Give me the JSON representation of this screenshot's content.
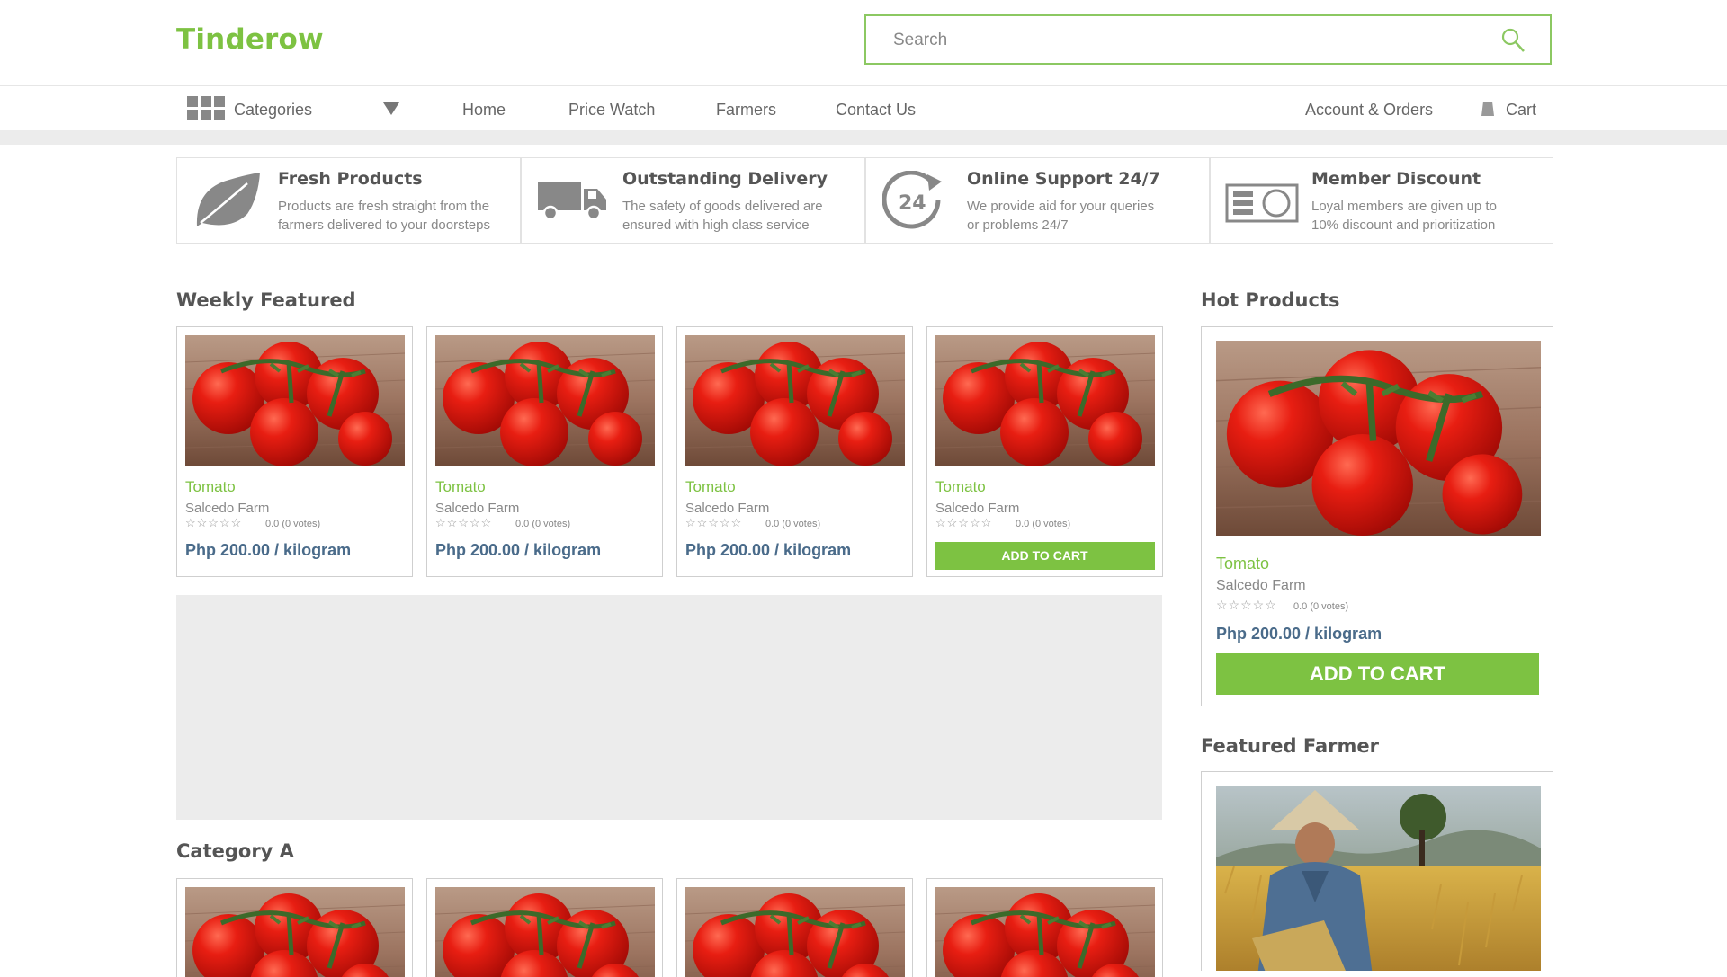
{
  "header": {
    "logo": "Tinderow",
    "search_placeholder": "Search"
  },
  "nav": {
    "categories_label": "Categories",
    "links": [
      "Home",
      "Price Watch",
      "Farmers",
      "Contact Us"
    ],
    "account_label": "Account & Orders",
    "cart_label": "Cart"
  },
  "features": [
    {
      "title": "Fresh Products",
      "line1": "Products are fresh straight from the",
      "line2": "farmers delivered to your doorsteps",
      "icon": "leaf-icon"
    },
    {
      "title": "Outstanding Delivery",
      "line1": "The safety of goods delivered are",
      "line2": "ensured with high class service",
      "icon": "truck-icon"
    },
    {
      "title": "Online Support 24/7",
      "line1": "We provide aid for your queries",
      "line2": "or problems 24/7",
      "icon": "support-24-icon"
    },
    {
      "title": "Member Discount",
      "line1": "Loyal members are given up to",
      "line2": "10% discount and prioritization",
      "icon": "member-card-icon"
    }
  ],
  "weekly_featured": {
    "title": "Weekly Featured",
    "products": [
      {
        "name": "Tomato",
        "farm": "Salcedo Farm",
        "stars": "☆☆☆☆☆",
        "votes": "0.0 (0 votes)",
        "price": "Php 200.00 / kilogram"
      },
      {
        "name": "Tomato",
        "farm": "Salcedo Farm",
        "stars": "☆☆☆☆☆",
        "votes": "0.0 (0 votes)",
        "price": "Php 200.00 / kilogram"
      },
      {
        "name": "Tomato",
        "farm": "Salcedo Farm",
        "stars": "☆☆☆☆☆",
        "votes": "0.0 (0 votes)",
        "price": "Php 200.00 / kilogram"
      },
      {
        "name": "Tomato",
        "farm": "Salcedo Farm",
        "stars": "☆☆☆☆☆",
        "votes": "0.0 (0 votes)",
        "add_to_cart": "ADD TO CART"
      }
    ]
  },
  "hot_products": {
    "title": "Hot Products",
    "product": {
      "name": "Tomato",
      "farm": "Salcedo Farm",
      "stars": "☆☆☆☆☆",
      "votes": "0.0 (0 votes)",
      "price": "Php 200.00 / kilogram",
      "add_to_cart": "ADD TO CART"
    }
  },
  "featured_farmer": {
    "title": "Featured Farmer"
  },
  "category_a": {
    "title": "Category A"
  },
  "colors": {
    "accent": "#7dc242",
    "price": "#4a6b8a",
    "text": "#555555"
  }
}
